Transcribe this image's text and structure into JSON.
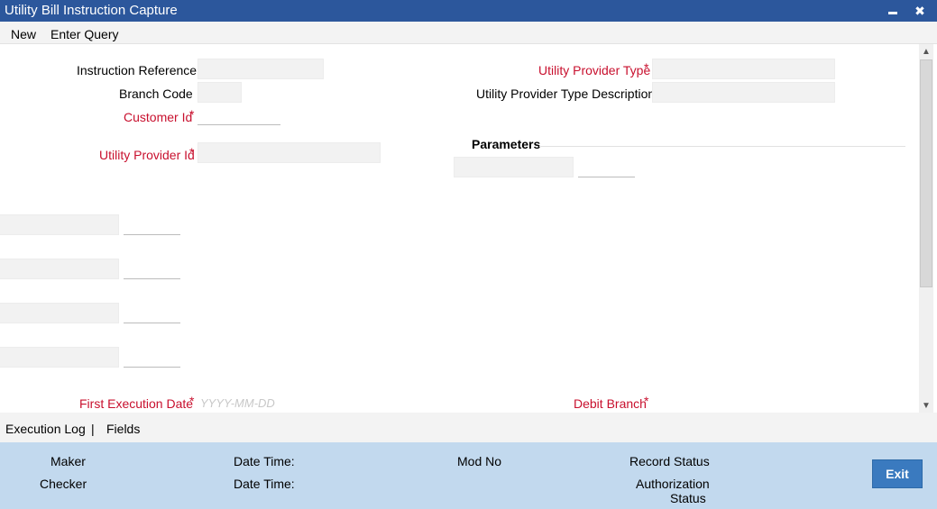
{
  "window": {
    "title": "Utility Bill Instruction Capture",
    "minimize_icon": "minimize-icon",
    "close_icon": "close-icon",
    "close_glyph": "✖"
  },
  "toolbar": {
    "new_label": "New",
    "enter_query_label": "Enter Query"
  },
  "form": {
    "instruction_reference_label": "Instruction Reference",
    "branch_code_label": "Branch Code",
    "customer_id_label": "Customer Id",
    "utility_provider_id_label": "Utility Provider Id",
    "utility_provider_type_label": "Utility Provider Type",
    "utility_provider_type_description_label": "Utility Provider Type Description",
    "parameters_title": "Parameters",
    "first_execution_date_label": "First Execution Date",
    "first_execution_date_placeholder": "YYYY-MM-DD",
    "debit_branch_label": "Debit Branch",
    "required_marker": "*"
  },
  "tabs": {
    "execution_log_label": "Execution Log",
    "separator": "|",
    "fields_label": "Fields"
  },
  "footer": {
    "maker_label": "Maker",
    "checker_label": "Checker",
    "date_time_label": "Date Time:",
    "mod_no_label": "Mod No",
    "record_status_label": "Record Status",
    "authorization_label": "Authorization",
    "status_label": "Status",
    "exit_label": "Exit"
  },
  "colors": {
    "titlebar": "#2c579c",
    "required": "#c8102e",
    "footer": "#c2d9ee",
    "exit_button": "#3a7abf"
  }
}
